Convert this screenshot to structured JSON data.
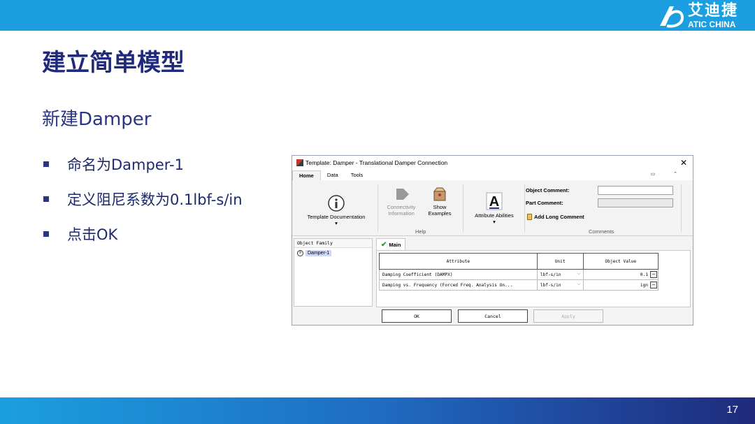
{
  "brand": {
    "name_cn": "艾迪捷",
    "name_en": "ATIC CHINA",
    "accent": "#1b9fe0",
    "navy": "#1f2a7c"
  },
  "slide": {
    "title": "建立简单模型",
    "section": "新建Damper",
    "bullets": [
      "命名为Damper-1",
      "定义阻尼系数为0.1lbf-s/in",
      "点击OK"
    ],
    "page_number": "17"
  },
  "dialog": {
    "title": "Template: Damper - Translational Damper Connection",
    "tabs": [
      "Home",
      "Data",
      "Tools"
    ],
    "ribbon": {
      "template_doc": "Template Documentation",
      "connectivity": "Connectivity",
      "information": "Information",
      "show": "Show",
      "examples": "Examples",
      "attribute_abilities": "Attribute Abilities",
      "help_group": "Help",
      "object_comment": "Object Comment:",
      "part_comment": "Part Comment:",
      "add_long_comment": "Add Long Comment",
      "comments_group": "Comments"
    },
    "object_family_header": "Object Family",
    "tree_item": "Damper-1",
    "main_tab": "Main",
    "grid": {
      "headers": [
        "Attribute",
        "Unit",
        "Object Value"
      ],
      "rows": [
        {
          "attribute": "Damping Coefficient (DAMPX)",
          "unit": "lbf-s/in",
          "value": "0.1"
        },
        {
          "attribute": "Damping vs. Frequency (Forced Freq. Analysis On...",
          "unit": "lbf-s/in",
          "value": "ign"
        }
      ]
    },
    "buttons": {
      "ok": "OK",
      "cancel": "Cancel",
      "apply": "Apply"
    }
  }
}
